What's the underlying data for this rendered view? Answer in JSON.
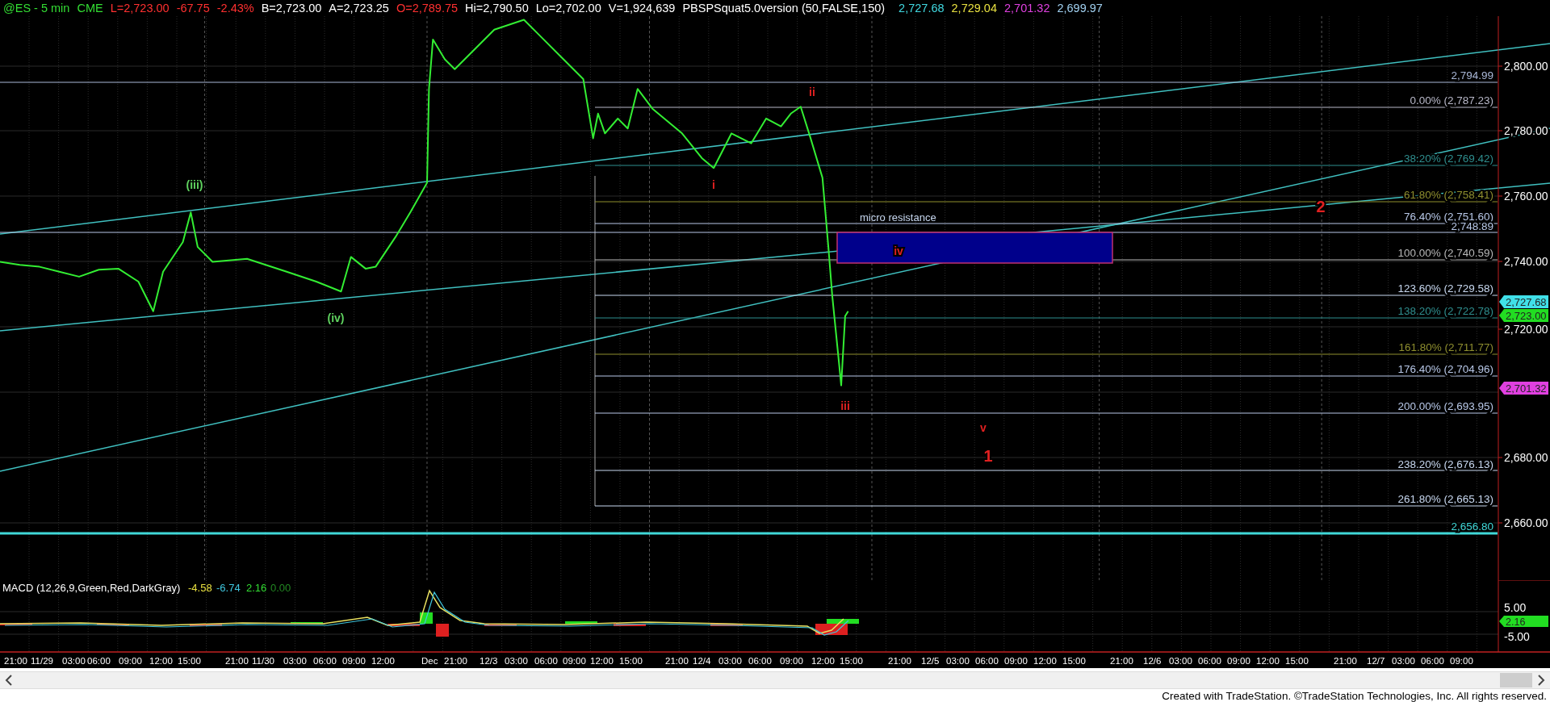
{
  "header": [
    {
      "text": "@ES - 5 min",
      "color": "#33dd33"
    },
    {
      "text": "CME",
      "color": "#33dd33"
    },
    {
      "text": "L=2,723.00",
      "color": "#ff3030"
    },
    {
      "text": "-67.75",
      "color": "#ff3030"
    },
    {
      "text": "-2.43%",
      "color": "#ff3030"
    },
    {
      "text": "B=2,723.00",
      "color": "#ffffff"
    },
    {
      "text": "A=2,723.25",
      "color": "#ffffff"
    },
    {
      "text": "O=2,789.75",
      "color": "#ff3030"
    },
    {
      "text": "Hi=2,790.50",
      "color": "#ffffff"
    },
    {
      "text": "Lo=2,702.00",
      "color": "#ffffff"
    },
    {
      "text": "V=1,924,639",
      "color": "#ffffff"
    },
    {
      "text": "PBSPSquat5.0version (50,FALSE,150)",
      "color": "#ffffff"
    },
    {
      "text": "2,727.68",
      "color": "#40d8e0"
    },
    {
      "text": "2,729.04",
      "color": "#e8e040"
    },
    {
      "text": "2,701.32",
      "color": "#e040e0"
    },
    {
      "text": "2,699.97",
      "color": "#a0d0f0"
    }
  ],
  "levels": [
    {
      "label": "2,794.99",
      "color": "#aab8d8"
    },
    {
      "label": "0.00% (2,787.23)",
      "color": "#b8b8c8"
    },
    {
      "label": "38.20% (2,769.42)",
      "color": "#2f8f8f"
    },
    {
      "label": "61.80% (2,758.41)",
      "color": "#8f8f2f"
    },
    {
      "label": "76.40% (2,751.60)",
      "color": "#b8c8e8"
    },
    {
      "label": "2,748.89",
      "color": "#b8c8e8"
    },
    {
      "label": "100.00% (2,740.59)",
      "color": "#b8b8b8"
    },
    {
      "label": "123.60% (2,729.58)",
      "color": "#c8d8f0"
    },
    {
      "label": "138.20% (2,722.78)",
      "color": "#2f8f8f"
    },
    {
      "label": "161.80% (2,711.77)",
      "color": "#8f8f2f"
    },
    {
      "label": "176.40% (2,704.96)",
      "color": "#b8c8e8"
    },
    {
      "label": "200.00% (2,693.95)",
      "color": "#b8c8e8"
    },
    {
      "label": "238.20% (2,676.13)",
      "color": "#c8d8f0"
    },
    {
      "label": "261.80% (2,665.13)",
      "color": "#c8d8f0"
    },
    {
      "label": "2,656.80",
      "color": "#40d8d8"
    }
  ],
  "zone": {
    "label": "micro resistance"
  },
  "wave_labels": [
    {
      "text": "(iii)",
      "kind": "minor",
      "color": "#5fd35f"
    },
    {
      "text": "(iv)",
      "kind": "minor",
      "color": "#5fd35f"
    },
    {
      "text": "i",
      "kind": "minor",
      "color": "#e02020"
    },
    {
      "text": "ii",
      "kind": "minor",
      "color": "#e02020"
    },
    {
      "text": "iii",
      "kind": "minor",
      "color": "#e02020"
    },
    {
      "text": "iv",
      "kind": "minor",
      "color": "#e02020"
    },
    {
      "text": "v",
      "kind": "minor",
      "color": "#e02020"
    },
    {
      "text": "1",
      "kind": "major",
      "color": "#e02020"
    },
    {
      "text": "2",
      "kind": "major",
      "color": "#e02020"
    }
  ],
  "price_axis": {
    "ticks": [
      "2,800.00",
      "2,780.00",
      "2,760.00",
      "2,740.00",
      "2,720.00",
      "2,680.00",
      "2,660.00"
    ],
    "tags": [
      {
        "text": "2,727.68",
        "color": "#40e0e8"
      },
      {
        "text": "2,723.00",
        "color": "#22dd22"
      },
      {
        "text": "2,701.32",
        "color": "#e040e0"
      }
    ]
  },
  "macd": {
    "title": "MACD (12,26,9,Green,Red,DarkGray)",
    "values": [
      {
        "text": "-4.58",
        "color": "#e8e040"
      },
      {
        "text": "-6.74",
        "color": "#40c8e0"
      },
      {
        "text": "2.16",
        "color": "#33dd33"
      },
      {
        "text": "0.00",
        "color": "#228822"
      }
    ],
    "ticks": [
      "5.00",
      "-5.00"
    ],
    "tag": {
      "text": "2.16",
      "color": "#22dd22"
    }
  },
  "time_axis": [
    "21:00",
    "11/29",
    "03:00",
    "06:00",
    "09:00",
    "12:00",
    "15:00",
    "21:00",
    "11/30",
    "03:00",
    "06:00",
    "09:00",
    "12:00",
    "Dec",
    "21:00",
    "12/3",
    "03:00",
    "06:00",
    "09:00",
    "12:00",
    "15:00",
    "21:00",
    "12/4",
    "03:00",
    "06:00",
    "09:00",
    "12:00",
    "15:00",
    "21:00",
    "12/5",
    "03:00",
    "06:00",
    "09:00",
    "12:00",
    "15:00",
    "21:00",
    "12/6",
    "03:00",
    "06:00",
    "09:00",
    "12:00",
    "15:00",
    "21:00",
    "12/7",
    "03:00",
    "06:00",
    "09:00"
  ],
  "footer": "Created with TradeStation. ©TradeStation Technologies, Inc. All rights reserved."
}
